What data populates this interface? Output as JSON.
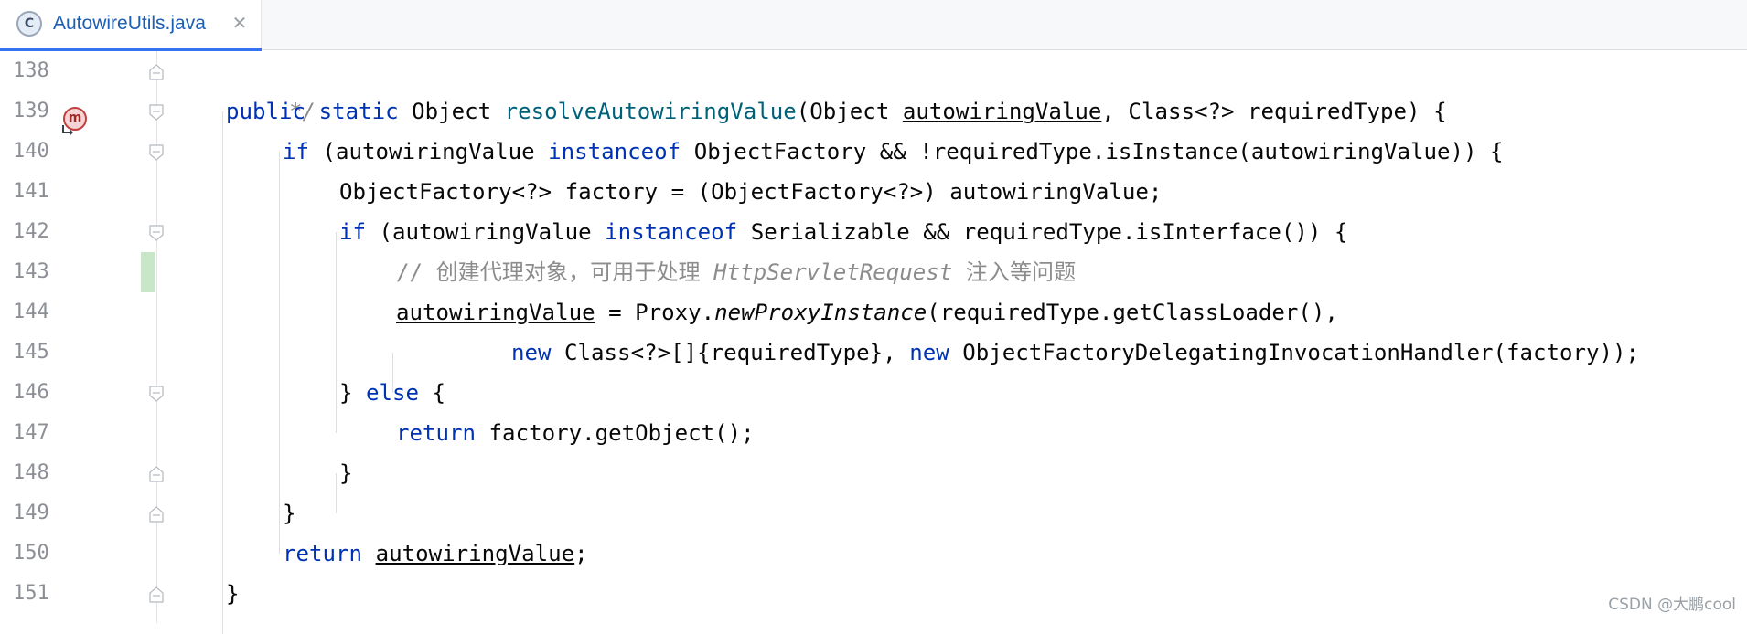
{
  "tab": {
    "icon_letter": "C",
    "label": "AutowireUtils.java",
    "close_glyph": "✕"
  },
  "gutter": {
    "method_icon_letter": "m",
    "line_numbers": [
      "138",
      "139",
      "140",
      "141",
      "142",
      "143",
      "144",
      "145",
      "146",
      "147",
      "148",
      "149",
      "150",
      "151"
    ]
  },
  "code": {
    "l138": {
      "t1": "*/"
    },
    "l139": {
      "t1": "public",
      "t2": " ",
      "t3": "static",
      "t4": " Object ",
      "t5": "resolveAutowiringValue",
      "t6": "(Object ",
      "t7": "autowiringValue",
      "t8": ", Class<?> requiredType) {"
    },
    "l140": {
      "t1": "if",
      "t2": " (autowiringValue ",
      "t3": "instanceof",
      "t4": " ObjectFactory && !requiredType.isInstance(autowiringValue)) {"
    },
    "l141": {
      "t1": "ObjectFactory<?> factory = (ObjectFactory<?>) autowiringValue;"
    },
    "l142": {
      "t1": "if",
      "t2": " (autowiringValue ",
      "t3": "instanceof",
      "t4": " Serializable && requiredType.isInterface()) {"
    },
    "l143": {
      "t1": "// 创建代理对象，可用于处理 ",
      "t2": "HttpServletRequest",
      "t3": " 注入等问题"
    },
    "l144": {
      "t1": "autowiringValue",
      "t2": " = Proxy.",
      "t3": "newProxyInstance",
      "t4": "(requiredType.getClassLoader(),"
    },
    "l145": {
      "t1": "new",
      "t2": " Class<?>[]{requiredType}, ",
      "t3": "new",
      "t4": " ObjectFactoryDelegatingInvocationHandler(factory));"
    },
    "l146": {
      "t1": "} ",
      "t2": "else",
      "t3": " {"
    },
    "l147": {
      "t1": "return",
      "t2": " factory.getObject();"
    },
    "l148": {
      "t1": "}"
    },
    "l149": {
      "t1": "}"
    },
    "l150": {
      "t1": "return",
      "t2": " ",
      "t3": "autowiringValue",
      "t4": ";"
    },
    "l151": {
      "t1": "}"
    }
  },
  "watermark": "CSDN @大鹏cool",
  "colors": {
    "keyword": "#0033b3",
    "method_declaration": "#00627a",
    "comment": "#8c8c8c",
    "line_number": "#8c9096",
    "tab_label": "#1c5fb5",
    "tab_underline": "#3574f0",
    "changed_line_marker": "#c9e6c8"
  }
}
